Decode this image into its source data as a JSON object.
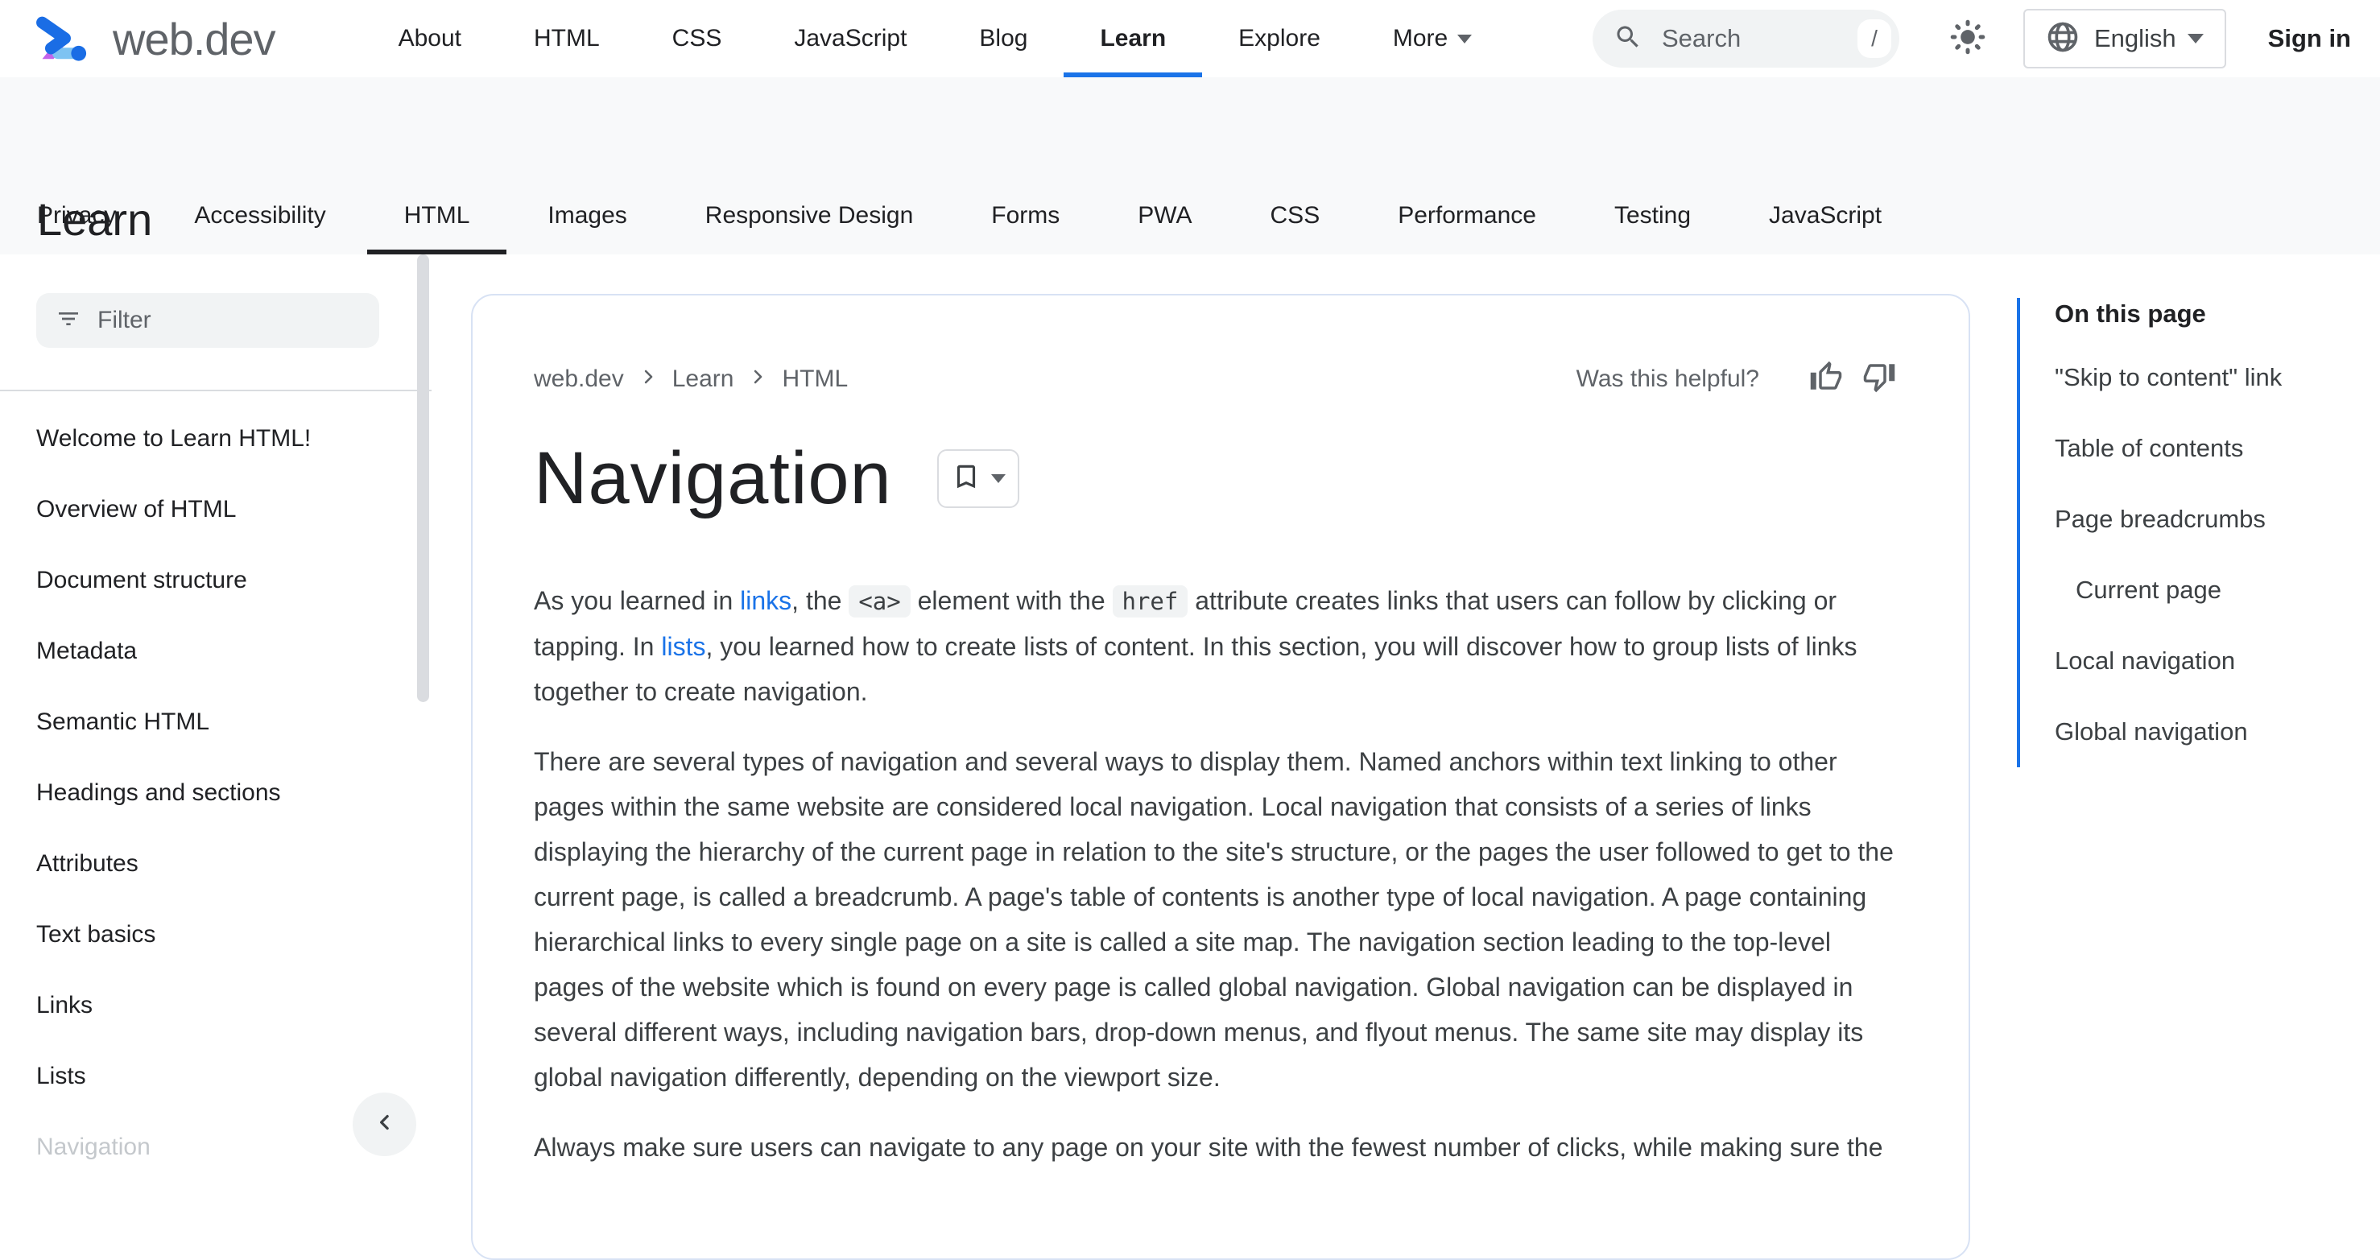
{
  "colors": {
    "accent_blue": "#1a73e8",
    "text_primary": "#202124",
    "text_secondary": "#5f6368",
    "text_body": "#3c4043",
    "fill_gray": "#f1f3f4",
    "band_gray": "#f8f9fa",
    "border_gray": "#dadce0",
    "card_border": "#d8e2f4",
    "logo_blue": "#1a6de5",
    "logo_purple": "#c263ea",
    "logo_lightblue": "#7ec3f2"
  },
  "header": {
    "logo_text": "web.dev",
    "nav": [
      {
        "label": "About",
        "active": false,
        "caret": false
      },
      {
        "label": "HTML",
        "active": false,
        "caret": false
      },
      {
        "label": "CSS",
        "active": false,
        "caret": false
      },
      {
        "label": "JavaScript",
        "active": false,
        "caret": false
      },
      {
        "label": "Blog",
        "active": false,
        "caret": false
      },
      {
        "label": "Learn",
        "active": true,
        "caret": false
      },
      {
        "label": "Explore",
        "active": false,
        "caret": false
      },
      {
        "label": "More",
        "active": false,
        "caret": true
      }
    ],
    "search": {
      "placeholder": "Search",
      "shortcut": "/"
    },
    "language": {
      "label": "English"
    },
    "sign_in_label": "Sign in"
  },
  "learn": {
    "title": "Learn",
    "tabs": [
      {
        "label": "Privacy",
        "active": false
      },
      {
        "label": "Accessibility",
        "active": false
      },
      {
        "label": "HTML",
        "active": true
      },
      {
        "label": "Images",
        "active": false
      },
      {
        "label": "Responsive Design",
        "active": false
      },
      {
        "label": "Forms",
        "active": false
      },
      {
        "label": "PWA",
        "active": false
      },
      {
        "label": "CSS",
        "active": false
      },
      {
        "label": "Performance",
        "active": false
      },
      {
        "label": "Testing",
        "active": false
      },
      {
        "label": "JavaScript",
        "active": false
      }
    ]
  },
  "sidebar": {
    "filter_placeholder": "Filter",
    "items": [
      {
        "label": "Welcome to Learn HTML!",
        "muted": false
      },
      {
        "label": "Overview of HTML",
        "muted": false
      },
      {
        "label": "Document structure",
        "muted": false
      },
      {
        "label": "Metadata",
        "muted": false
      },
      {
        "label": "Semantic HTML",
        "muted": false
      },
      {
        "label": "Headings and sections",
        "muted": false
      },
      {
        "label": "Attributes",
        "muted": false
      },
      {
        "label": "Text basics",
        "muted": false
      },
      {
        "label": "Links",
        "muted": false
      },
      {
        "label": "Lists",
        "muted": false
      },
      {
        "label": "Navigation",
        "muted": true
      }
    ]
  },
  "article": {
    "breadcrumb": [
      "web.dev",
      "Learn",
      "HTML"
    ],
    "helpful_label": "Was this helpful?",
    "title": "Navigation",
    "paragraphs": [
      [
        {
          "t": "text",
          "s": "As you learned in "
        },
        {
          "t": "link",
          "s": "links"
        },
        {
          "t": "text",
          "s": ", the "
        },
        {
          "t": "code",
          "s": "<a>"
        },
        {
          "t": "text",
          "s": " element with the "
        },
        {
          "t": "code",
          "s": "href"
        },
        {
          "t": "text",
          "s": " attribute creates links that users can follow by clicking or tapping. In "
        },
        {
          "t": "link",
          "s": "lists"
        },
        {
          "t": "text",
          "s": ", you learned how to create lists of content. In this section, you will discover how to group lists of links together to create navigation."
        }
      ],
      [
        {
          "t": "text",
          "s": "There are several types of navigation and several ways to display them. Named anchors within text linking to other pages within the same website are considered local navigation. Local navigation that consists of a series of links displaying the hierarchy of the current page in relation to the site's structure, or the pages the user followed to get to the current page, is called a breadcrumb. A page's table of contents is another type of local navigation. A page containing hierarchical links to every single page on a site is called a site map. The navigation section leading to the top-level pages of the website which is found on every page is called global navigation. Global navigation can be displayed in several different ways, including navigation bars, drop-down menus, and flyout menus. The same site may display its global navigation differently, depending on the viewport size."
        }
      ],
      [
        {
          "t": "text",
          "s": "Always make sure users can navigate to any page on your site with the fewest number of clicks, while making sure the"
        }
      ]
    ]
  },
  "toc": {
    "title": "On this page",
    "items": [
      {
        "label": "\"Skip to content\" link",
        "indent": false
      },
      {
        "label": "Table of contents",
        "indent": false
      },
      {
        "label": "Page breadcrumbs",
        "indent": false
      },
      {
        "label": "Current page",
        "indent": true
      },
      {
        "label": "Local navigation",
        "indent": false
      },
      {
        "label": "Global navigation",
        "indent": false
      }
    ]
  }
}
